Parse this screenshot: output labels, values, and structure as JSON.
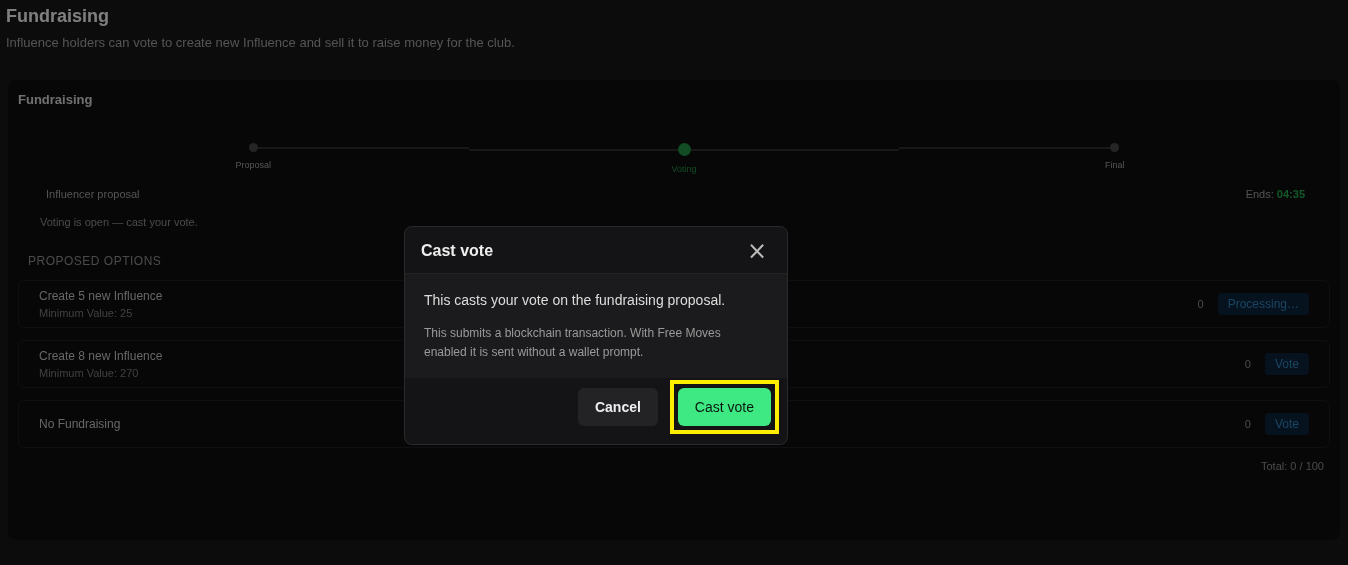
{
  "page": {
    "title": "Fundraising",
    "subtitle": "Influence holders can vote to create new Influence and sell it to raise money for the club."
  },
  "card": {
    "title": "Fundraising",
    "steps": [
      {
        "label": "Proposal",
        "selected": false
      },
      {
        "label": "Voting",
        "selected": true
      },
      {
        "label": "Final",
        "selected": false
      }
    ],
    "proposal_label": "Influencer proposal",
    "ends_label": "Ends:",
    "ends_time": "04:35",
    "status": "Voting is open — cast your vote.",
    "options_heading": "PROPOSED OPTIONS",
    "options": [
      {
        "title": "Create 5 new Influence",
        "subtitle": "Minimum Value: 25",
        "votes": "0",
        "action": "Processing…"
      },
      {
        "title": "Create 8 new Influence",
        "subtitle": "Minimum Value: 270",
        "votes": "0",
        "action": "Vote"
      },
      {
        "title": "No Fundraising",
        "votes": "0",
        "action": "Vote"
      }
    ],
    "total": "Total: 0 / 100"
  },
  "dialog": {
    "title": "Cast vote",
    "close": "×",
    "message": "This casts your vote on the fundraising proposal.",
    "note": "This submits a blockchain transaction. With Free Moves enabled it is sent without a wallet prompt.",
    "buttons": [
      {
        "label": "Cancel",
        "kind": "secondary",
        "highlighted": false
      },
      {
        "label": "Cast vote",
        "kind": "primary",
        "highlighted": true
      }
    ]
  }
}
